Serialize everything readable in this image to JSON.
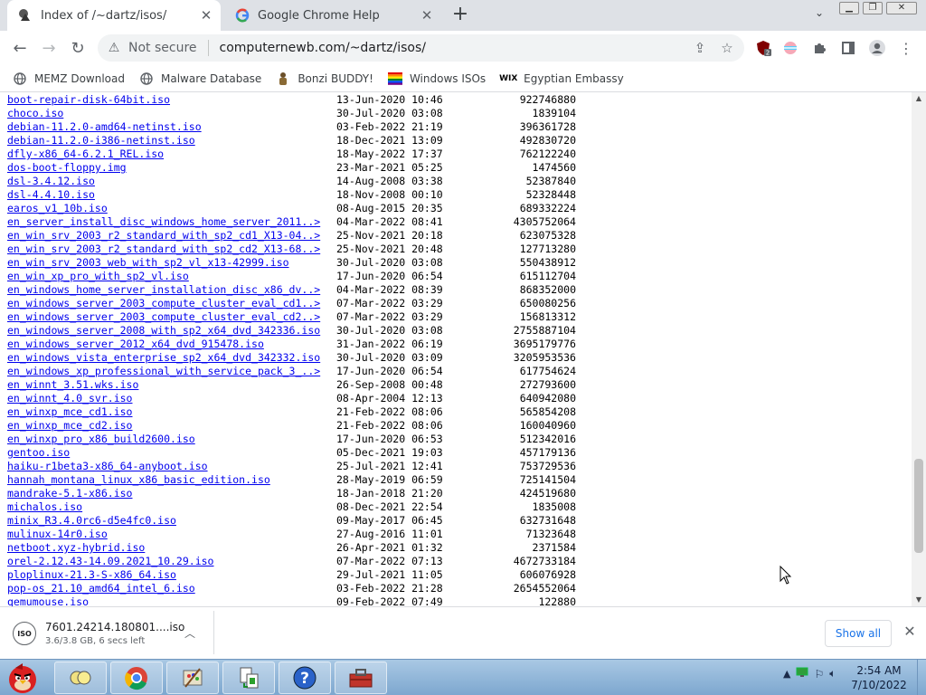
{
  "tabs": [
    {
      "title": "Index of /~dartz/isos/",
      "active": true,
      "icon": "dartz-favicon-icon"
    },
    {
      "title": "Google Chrome Help",
      "active": false,
      "icon": "google-g-icon"
    }
  ],
  "toolbar": {
    "security_label": "Not secure",
    "url": "computernewb.com/~dartz/isos/"
  },
  "bookmarks": [
    {
      "label": "MEMZ Download",
      "icon": "globe-icon"
    },
    {
      "label": "Malware Database",
      "icon": "globe-icon"
    },
    {
      "label": "Bonzi BUDDY!",
      "icon": "bonzi-icon"
    },
    {
      "label": "Windows ISOs",
      "icon": "windows-flag-icon"
    },
    {
      "label": "Egyptian Embassy",
      "icon": "wix-icon"
    }
  ],
  "listing": [
    {
      "name": "boot-repair-disk-64bit.iso",
      "date": "13-Jun-2020 10:46",
      "size": "922746880"
    },
    {
      "name": "choco.iso",
      "date": "30-Jul-2020 03:08",
      "size": "1839104"
    },
    {
      "name": "debian-11.2.0-amd64-netinst.iso",
      "date": "03-Feb-2022 21:19",
      "size": "396361728"
    },
    {
      "name": "debian-11.2.0-i386-netinst.iso",
      "date": "18-Dec-2021 13:09",
      "size": "492830720"
    },
    {
      "name": "dfly-x86_64-6.2.1_REL.iso",
      "date": "18-May-2022 17:37",
      "size": "762122240"
    },
    {
      "name": "dos-boot-floppy.img",
      "date": "23-Mar-2021 05:25",
      "size": "1474560"
    },
    {
      "name": "dsl-3.4.12.iso",
      "date": "14-Aug-2008 03:38",
      "size": "52387840"
    },
    {
      "name": "dsl-4.4.10.iso",
      "date": "18-Nov-2008 00:10",
      "size": "52328448"
    },
    {
      "name": "earos_v1_10b.iso",
      "date": "08-Aug-2015 20:35",
      "size": "689332224"
    },
    {
      "name": "en_server_install_disc_windows_home_server_2011..>",
      "date": "04-Mar-2022 08:41",
      "size": "4305752064"
    },
    {
      "name": "en_win_srv_2003_r2_standard_with_sp2_cd1_X13-04..>",
      "date": "25-Nov-2021 20:18",
      "size": "623075328"
    },
    {
      "name": "en_win_srv_2003_r2_standard_with_sp2_cd2_X13-68..>",
      "date": "25-Nov-2021 20:48",
      "size": "127713280"
    },
    {
      "name": "en_win_srv_2003_web_with_sp2_vl_x13-42999.iso",
      "date": "30-Jul-2020 03:08",
      "size": "550438912"
    },
    {
      "name": "en_win_xp_pro_with_sp2_vl.iso",
      "date": "17-Jun-2020 06:54",
      "size": "615112704"
    },
    {
      "name": "en_windows_home_server_installation_disc_x86_dv..>",
      "date": "04-Mar-2022 08:39",
      "size": "868352000"
    },
    {
      "name": "en_windows_server_2003_compute_cluster_eval_cd1..>",
      "date": "07-Mar-2022 03:29",
      "size": "650080256"
    },
    {
      "name": "en_windows_server_2003_compute_cluster_eval_cd2..>",
      "date": "07-Mar-2022 03:29",
      "size": "156813312"
    },
    {
      "name": "en_windows_server_2008_with_sp2_x64_dvd_342336.iso",
      "date": "30-Jul-2020 03:08",
      "size": "2755887104"
    },
    {
      "name": "en_windows_server_2012_x64_dvd_915478.iso",
      "date": "31-Jan-2022 06:19",
      "size": "3695179776"
    },
    {
      "name": "en_windows_vista_enterprise_sp2_x64_dvd_342332.iso",
      "date": "30-Jul-2020 03:09",
      "size": "3205953536"
    },
    {
      "name": "en_windows_xp_professional_with_service_pack_3_..>",
      "date": "17-Jun-2020 06:54",
      "size": "617754624"
    },
    {
      "name": "en_winnt_3.51.wks.iso",
      "date": "26-Sep-2008 00:48",
      "size": "272793600"
    },
    {
      "name": "en_winnt_4.0_svr.iso",
      "date": "08-Apr-2004 12:13",
      "size": "640942080"
    },
    {
      "name": "en_winxp_mce_cd1.iso",
      "date": "21-Feb-2022 08:06",
      "size": "565854208"
    },
    {
      "name": "en_winxp_mce_cd2.iso",
      "date": "21-Feb-2022 08:06",
      "size": "160040960"
    },
    {
      "name": "en_winxp_pro_x86_build2600.iso",
      "date": "17-Jun-2020 06:53",
      "size": "512342016"
    },
    {
      "name": "gentoo.iso",
      "date": "05-Dec-2021 19:03",
      "size": "457179136"
    },
    {
      "name": "haiku-r1beta3-x86_64-anyboot.iso",
      "date": "25-Jul-2021 12:41",
      "size": "753729536"
    },
    {
      "name": "hannah_montana_linux_x86_basic_edition.iso",
      "date": "28-May-2019 06:59",
      "size": "725141504"
    },
    {
      "name": "mandrake-5.1-x86.iso",
      "date": "18-Jan-2018 21:20",
      "size": "424519680"
    },
    {
      "name": "michalos.iso",
      "date": "08-Dec-2021 22:54",
      "size": "1835008"
    },
    {
      "name": "minix_R3.4.0rc6-d5e4fc0.iso",
      "date": "09-May-2017 06:45",
      "size": "632731648"
    },
    {
      "name": "mulinux-14r0.iso",
      "date": "27-Aug-2016 11:01",
      "size": "71323648"
    },
    {
      "name": "netboot.xyz-hybrid.iso",
      "date": "26-Apr-2021 01:32",
      "size": "2371584"
    },
    {
      "name": "orel-2.12.43-14.09.2021_10.29.iso",
      "date": "07-Mar-2022 07:13",
      "size": "4672733184"
    },
    {
      "name": "ploplinux-21.3-S-x86_64.iso",
      "date": "29-Jul-2021 11:05",
      "size": "606076928"
    },
    {
      "name": "pop-os_21.10_amd64_intel_6.iso",
      "date": "03-Feb-2022 21:28",
      "size": "2654552064"
    },
    {
      "name": "qemumouse.iso",
      "date": "09-Feb-2022 07:49",
      "size": "122880"
    }
  ],
  "download": {
    "filename": "7601.24214.180801....iso",
    "status": "3.6/3.8 GB, 6 secs left",
    "icon_text": "ISO"
  },
  "shelf": {
    "show_all": "Show all"
  },
  "clock": {
    "time": "2:54 AM",
    "date": "7/10/2022"
  },
  "colors": {
    "link": "#0000ee",
    "accent": "#1a73e8"
  }
}
